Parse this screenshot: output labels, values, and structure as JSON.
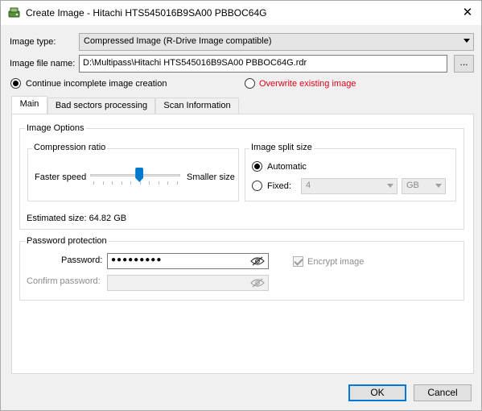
{
  "window": {
    "title": "Create Image - Hitachi HTS545016B9SA00 PBBOC64G",
    "close_label": "✕"
  },
  "image_type": {
    "label": "Image type:",
    "value": "Compressed Image (R-Drive Image compatible)"
  },
  "image_file": {
    "label": "Image file name:",
    "value": "D:\\Multipass\\Hitachi HTS545016B9SA00 PBBOC64G.rdr",
    "browse_label": "..."
  },
  "mode": {
    "continue_label": "Continue incomplete image creation",
    "continue_checked": true,
    "overwrite_label": "Overwrite existing image",
    "overwrite_checked": false,
    "overwrite_color": "#e0001a"
  },
  "tabs": [
    {
      "label": "Main",
      "active": true
    },
    {
      "label": "Bad sectors processing",
      "active": false
    },
    {
      "label": "Scan Information",
      "active": false
    }
  ],
  "image_options": {
    "title": "Image Options",
    "compression": {
      "title": "Compression ratio",
      "left_label": "Faster speed",
      "right_label": "Smaller size",
      "level_fraction": 0.55
    },
    "split": {
      "title": "Image split size",
      "automatic_label": "Automatic",
      "automatic_checked": true,
      "fixed_label": "Fixed:",
      "fixed_checked": false,
      "size_value": "4",
      "unit_value": "GB"
    },
    "estimated_size": "Estimated size: 64.82 GB"
  },
  "password": {
    "title": "Password protection",
    "password_label": "Password:",
    "password_value": "●●●●●●●●●",
    "confirm_label": "Confirm password:",
    "confirm_value": "",
    "encrypt_label": "Encrypt image",
    "encrypt_checked": true
  },
  "footer": {
    "ok_label": "OK",
    "cancel_label": "Cancel"
  },
  "colors": {
    "accent": "#0078d7",
    "slider_thumb": "#007acc"
  }
}
